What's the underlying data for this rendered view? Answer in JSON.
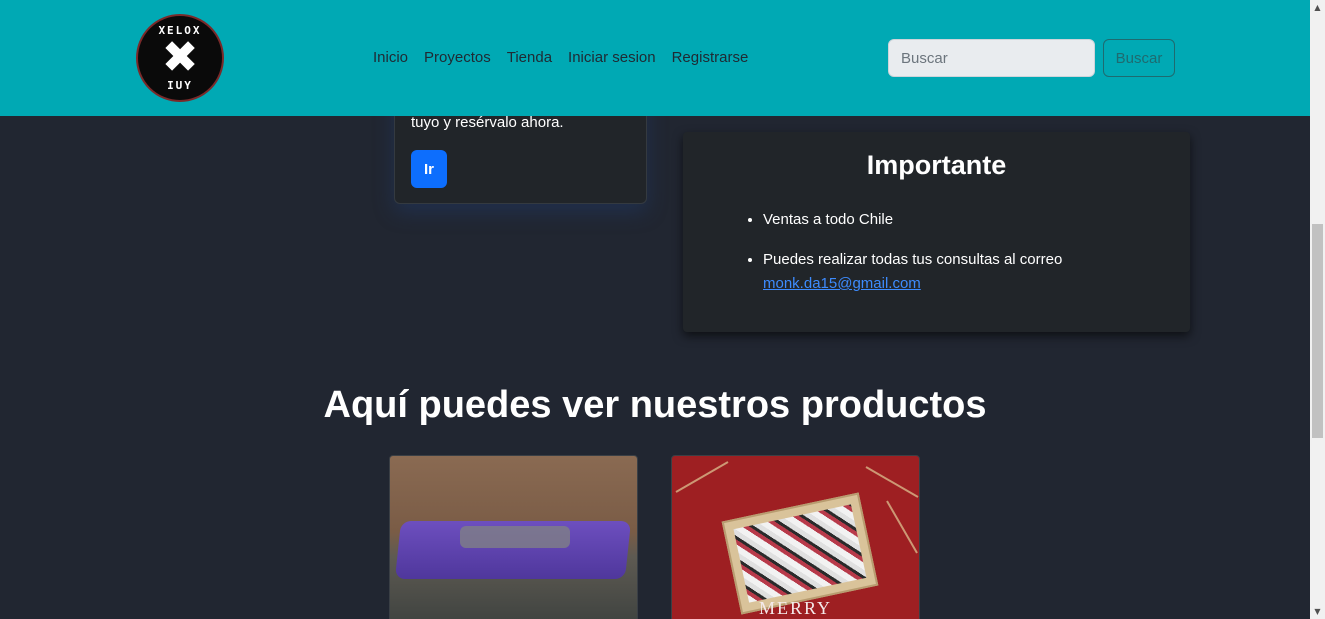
{
  "navbar": {
    "logo_top": "XELOX",
    "logo_mark": "✖",
    "logo_bottom": "IUY",
    "links": [
      "Inicio",
      "Proyectos",
      "Tienda",
      "Iniciar sesion",
      "Registrarse"
    ],
    "search_placeholder": "Buscar",
    "search_button": "Buscar",
    "color": "#00a9b4"
  },
  "left_card": {
    "text": "tuyo y resérvalo ahora.",
    "button_label": "Ir"
  },
  "important": {
    "title": "Importante",
    "item_1": "Ventas a todo Chile",
    "item_2": "Puedes realizar todas tus consultas al correo",
    "email": "monk.da15@gmail.com"
  },
  "products": {
    "heading": "Aquí puedes ver nuestros productos",
    "card_2_caption": "MERRY"
  },
  "icons": [
    "logo-icon",
    "scroll-up-icon",
    "scroll-down-icon"
  ]
}
